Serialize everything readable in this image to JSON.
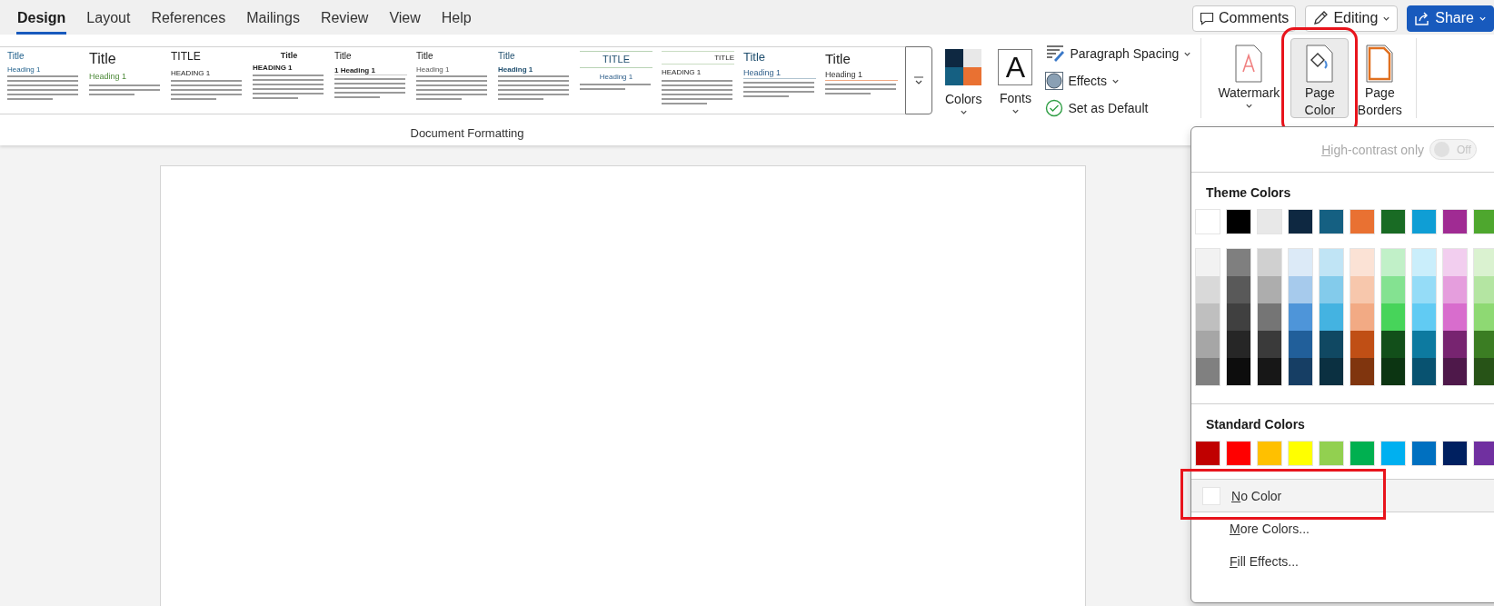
{
  "tabs": [
    {
      "label": "Design",
      "selected": true
    },
    {
      "label": "Layout",
      "selected": false
    },
    {
      "label": "References",
      "selected": false
    },
    {
      "label": "Mailings",
      "selected": false
    },
    {
      "label": "Review",
      "selected": false
    },
    {
      "label": "View",
      "selected": false
    },
    {
      "label": "Help",
      "selected": false
    }
  ],
  "top_buttons": [
    {
      "kind": "comments",
      "label": "Comments"
    },
    {
      "kind": "editing",
      "label": "Editing"
    },
    {
      "kind": "share",
      "label": "Share"
    }
  ],
  "style_gallery": {
    "group_label": "Document Formatting",
    "items": [
      {
        "kind": "blue",
        "title": "Title",
        "heading": "Heading 1"
      },
      {
        "kind": "large",
        "title": "Title",
        "heading": "Heading 1"
      },
      {
        "kind": "caps",
        "title": "TITLE",
        "heading": "HEADING 1"
      },
      {
        "kind": "bold",
        "title": "Title",
        "heading": "HEADING 1"
      },
      {
        "kind": "numbered",
        "title": "Title",
        "heading": "1 Heading 1"
      },
      {
        "kind": "plain",
        "title": "Title",
        "heading": "Heading 1"
      },
      {
        "kind": "navy",
        "title": "Title",
        "heading": "Heading 1"
      },
      {
        "kind": "ruled-center",
        "title": "TITLE",
        "heading": "Heading 1"
      },
      {
        "kind": "ruled-right",
        "title": "TITLE",
        "heading": "HEADING 1"
      },
      {
        "kind": "navy-large",
        "title": "Title",
        "heading": "Heading 1"
      },
      {
        "kind": "large-orange",
        "title": "Title",
        "heading": "Heading 1"
      }
    ]
  },
  "theme_group": {
    "colors_label": "Colors",
    "fonts_label": "Fonts",
    "fonts_glyph": "A",
    "options": [
      {
        "kind": "spacing",
        "label": "Paragraph Spacing",
        "dropdown": true
      },
      {
        "kind": "effects",
        "label": "Effects",
        "dropdown": true
      },
      {
        "kind": "default",
        "label": "Set as Default",
        "dropdown": false
      }
    ]
  },
  "page_background": [
    {
      "kind": "watermark",
      "label": "Watermark",
      "selected": false,
      "annotated": false
    },
    {
      "kind": "page-color",
      "label": "Page Color",
      "selected": true,
      "annotated": true
    },
    {
      "kind": "page-borders",
      "label": "Page Borders",
      "selected": false,
      "annotated": false
    }
  ],
  "color_menu": {
    "high_contrast": {
      "key": "H",
      "rest": "igh-contrast only",
      "on": false,
      "state_text": "Off"
    },
    "theme_title": "Theme Colors",
    "theme_colors": [
      {
        "color": "#ffffff"
      },
      {
        "color": "#000000"
      },
      {
        "color": "#e8e8e8"
      },
      {
        "color": "#0e2841"
      },
      {
        "color": "#156082"
      },
      {
        "color": "#e97132"
      },
      {
        "color": "#196b24"
      },
      {
        "color": "#0f9ed5"
      },
      {
        "color": "#a02b93"
      },
      {
        "color": "#4ea72e"
      }
    ],
    "shade_columns": [
      {
        "shades": [
          {
            "color": "#f2f2f2"
          },
          {
            "color": "#d9d9d9"
          },
          {
            "color": "#bfbfbf"
          },
          {
            "color": "#a6a6a6"
          },
          {
            "color": "#808080"
          }
        ]
      },
      {
        "shades": [
          {
            "color": "#7f7f7f"
          },
          {
            "color": "#595959"
          },
          {
            "color": "#404040"
          },
          {
            "color": "#262626"
          },
          {
            "color": "#0d0d0d"
          }
        ]
      },
      {
        "shades": [
          {
            "color": "#d0d0d0"
          },
          {
            "color": "#adadad"
          },
          {
            "color": "#757575"
          },
          {
            "color": "#3a3a3a"
          },
          {
            "color": "#171717"
          }
        ]
      },
      {
        "shades": [
          {
            "color": "#dceaf7"
          },
          {
            "color": "#a6caec"
          },
          {
            "color": "#4e95d9"
          },
          {
            "color": "#215f9a"
          },
          {
            "color": "#163e64"
          }
        ]
      },
      {
        "shades": [
          {
            "color": "#c0e4f5"
          },
          {
            "color": "#83cbeb"
          },
          {
            "color": "#44b3e1"
          },
          {
            "color": "#104862"
          },
          {
            "color": "#0b3041"
          }
        ]
      },
      {
        "shades": [
          {
            "color": "#fbe2d5"
          },
          {
            "color": "#f7c7ac"
          },
          {
            "color": "#f2aa84"
          },
          {
            "color": "#c04f15"
          },
          {
            "color": "#80350e"
          }
        ]
      },
      {
        "shades": [
          {
            "color": "#c1f0c8"
          },
          {
            "color": "#84e291"
          },
          {
            "color": "#47d45a"
          },
          {
            "color": "#124f1a"
          },
          {
            "color": "#0c3512"
          }
        ]
      },
      {
        "shades": [
          {
            "color": "#caeefb"
          },
          {
            "color": "#95dcf7"
          },
          {
            "color": "#61cbf3"
          },
          {
            "color": "#0d7aa0"
          },
          {
            "color": "#085270"
          }
        ]
      },
      {
        "shades": [
          {
            "color": "#f2ceef"
          },
          {
            "color": "#e59edd"
          },
          {
            "color": "#d86dcd"
          },
          {
            "color": "#772470"
          },
          {
            "color": "#4e184a"
          }
        ]
      },
      {
        "shades": [
          {
            "color": "#daf2d0"
          },
          {
            "color": "#b4e5a2"
          },
          {
            "color": "#8ed973"
          },
          {
            "color": "#3b7d23"
          },
          {
            "color": "#275317"
          }
        ]
      }
    ],
    "standard_title": "Standard Colors",
    "standard_colors": [
      {
        "color": "#c00000"
      },
      {
        "color": "#ff0000"
      },
      {
        "color": "#ffc000"
      },
      {
        "color": "#ffff00"
      },
      {
        "color": "#92d050"
      },
      {
        "color": "#00b050"
      },
      {
        "color": "#00b0f0"
      },
      {
        "color": "#0070c0"
      },
      {
        "color": "#002060"
      },
      {
        "color": "#7030a0"
      }
    ],
    "items": [
      {
        "kind": "swatch",
        "key": "N",
        "rest": "o Color",
        "selected": true,
        "annotated": true
      },
      {
        "kind": "plain",
        "key": "M",
        "rest": "ore Colors...",
        "selected": false,
        "annotated": false
      },
      {
        "kind": "plain",
        "key": "F",
        "rest": "ill Effects...",
        "selected": false,
        "annotated": false
      }
    ]
  }
}
